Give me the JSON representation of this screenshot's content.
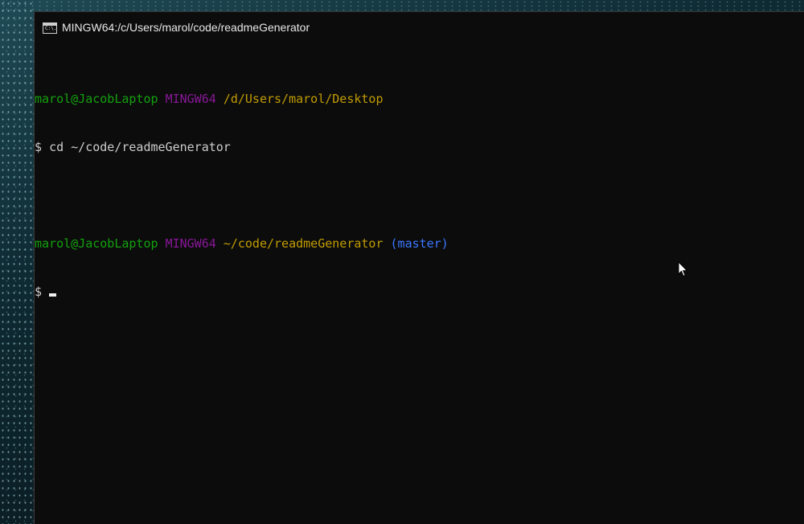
{
  "window": {
    "title": "MINGW64:/c/Users/marol/code/readmeGenerator",
    "icon": "console-icon",
    "icon_text": "C:\\."
  },
  "colors": {
    "background": "#0c0c0c",
    "user": "#13a10e",
    "host": "#881798",
    "path": "#c19c00",
    "branch": "#3b78ff",
    "text": "#cccccc"
  },
  "console": {
    "block1": {
      "user": "marol@JacobLaptop",
      "host": "MINGW64",
      "path": "/d/Users/marol/Desktop",
      "prompt": "$",
      "command": "cd ~/code/readmeGenerator"
    },
    "block2": {
      "user": "marol@JacobLaptop",
      "host": "MINGW64",
      "path": "~/code/readmeGenerator",
      "branch": "(master)",
      "prompt": "$"
    }
  },
  "pointer": {
    "icon": "mouse-pointer-icon"
  }
}
